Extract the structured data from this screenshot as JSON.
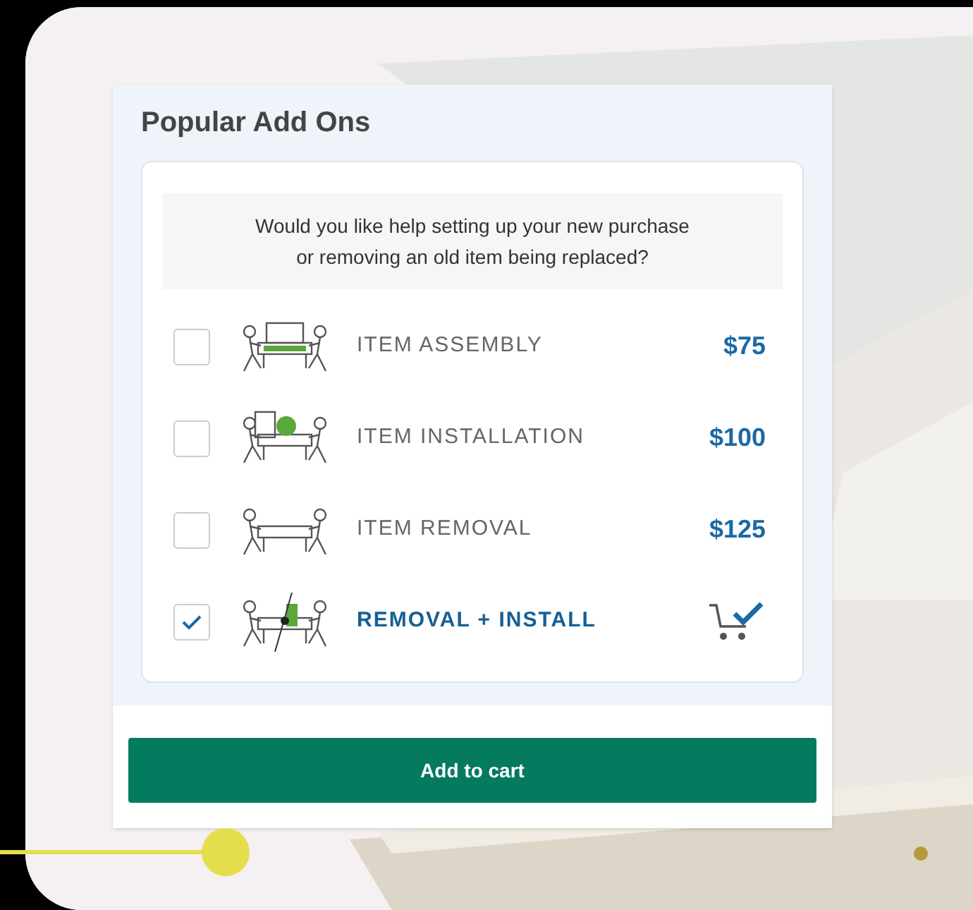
{
  "card": {
    "title": "Popular Add Ons",
    "question": "Would you like help setting up your new purchase or removing an old item being replaced?",
    "items": [
      {
        "label": "ITEM ASSEMBLY",
        "price": "$75",
        "checked": false
      },
      {
        "label": "ITEM INSTALLATION",
        "price": "$100",
        "checked": false
      },
      {
        "label": "ITEM REMOVAL",
        "price": "$125",
        "checked": false
      },
      {
        "label": "REMOVAL + INSTALL",
        "checked": true
      }
    ],
    "button": "Add to cart"
  }
}
